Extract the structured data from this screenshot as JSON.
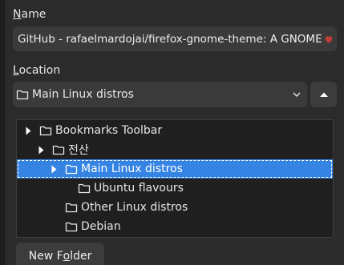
{
  "dialog": {
    "name_label_mnemonic": "N",
    "name_label_rest": "ame",
    "name_value": "GitHub - rafaelmardojai/firefox-gnome-theme: A GNOME",
    "location_label_mnemonic": "L",
    "location_label_rest": "ocation",
    "location_value": "Main Linux distros",
    "new_folder_prefix": "New F",
    "new_folder_mnemonic": "o",
    "new_folder_suffix": "lder"
  },
  "tree": {
    "rows": [
      {
        "label": "Bookmarks Toolbar",
        "expander": "collapsed"
      },
      {
        "label": "전산",
        "expander": "collapsed"
      },
      {
        "label": "Main Linux distros",
        "expander": "collapsed",
        "selected": true
      },
      {
        "label": "Ubuntu flavours",
        "expander": "none"
      },
      {
        "label": "Other Linux distros",
        "expander": "none"
      },
      {
        "label": "Debian",
        "expander": "none"
      }
    ]
  },
  "icons": {
    "folder": "folder-icon",
    "expander": "triangle-right-icon",
    "dropdown": "chevron-down-icon",
    "collapse": "triangle-up-icon",
    "favicon": "github-favicon-icon"
  },
  "colors": {
    "selection": "#3584e4",
    "favicon": "#c23b3b"
  }
}
